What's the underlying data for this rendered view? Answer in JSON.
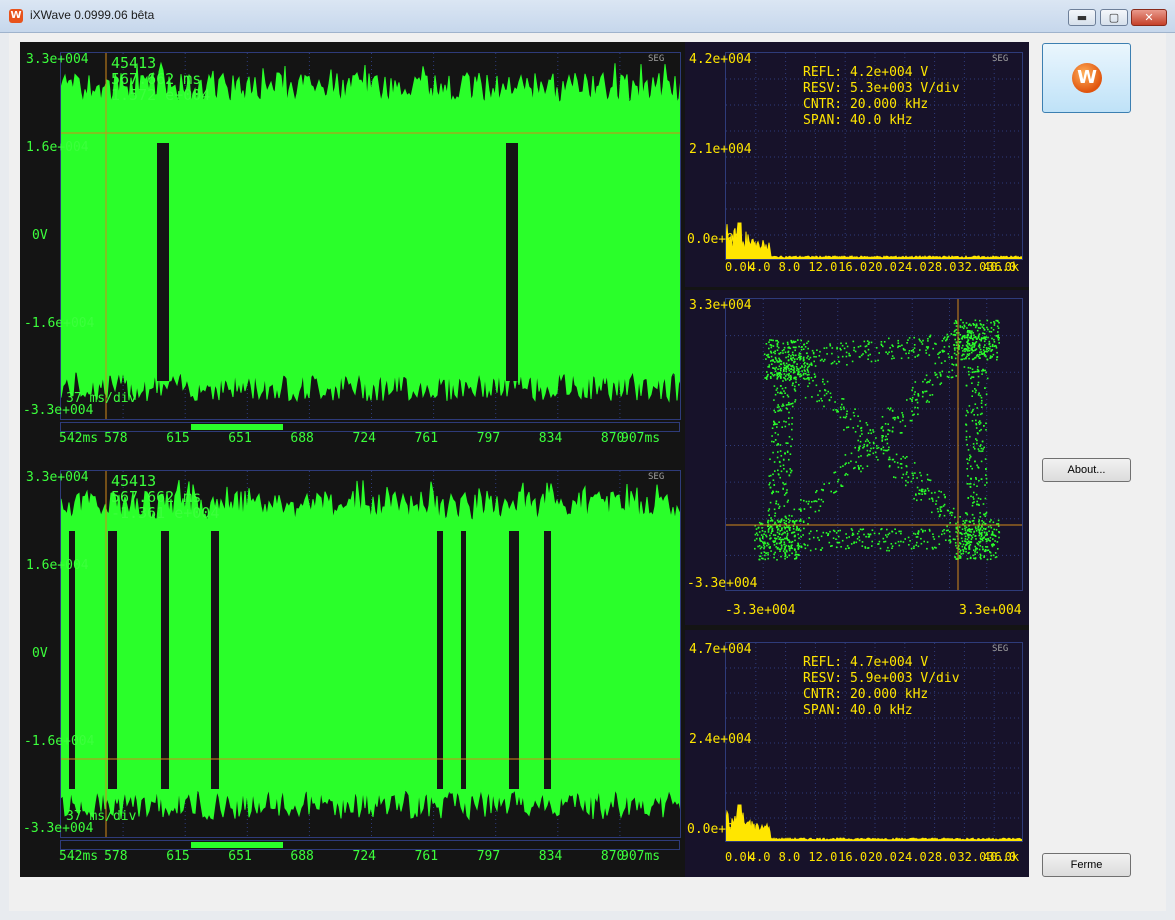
{
  "window": {
    "title": "iXWave 0.0999.06 bêta",
    "icon": "W",
    "controls": {
      "minimize": "▬",
      "maximize": "▢",
      "close": "✕"
    }
  },
  "buttons": {
    "logo": "W",
    "about": "About...",
    "close": "Ferme"
  },
  "colors": {
    "trace": "#2aff2a",
    "cursor": "#d38a1a",
    "spectrum": "#ffe600",
    "grid": "#2e3b7a",
    "panel": "#17122a"
  },
  "time_panels": [
    {
      "y_max": "3.3e+004",
      "y_mid_high": "1.6e+004",
      "y_zero": "0V",
      "y_mid_low": "-1.6e+004",
      "y_min": "-3.3e+004",
      "readout": [
        "45413",
        "567.662 ms",
        "1.572 e+004"
      ],
      "scale": "37 ms/div",
      "tag": "SEG",
      "x_ticks": [
        "542ms",
        "578",
        "615",
        "651",
        "688",
        "724",
        "761",
        "797",
        "834",
        "870",
        "907ms"
      ],
      "scroll": {
        "start": 0.21,
        "end": 0.36
      }
    },
    {
      "y_max": "3.3e+004",
      "y_mid_high": "1.6e+004",
      "y_zero": "0V",
      "y_mid_low": "-1.6e+004",
      "y_min": "-3.3e+004",
      "readout": [
        "45413",
        "567.662 ms",
        "-1.361 e+004"
      ],
      "scale": "37 ms/div",
      "tag": "SEG",
      "x_ticks": [
        "542ms",
        "578",
        "615",
        "651",
        "688",
        "724",
        "761",
        "797",
        "834",
        "870",
        "907ms"
      ],
      "scroll": {
        "start": 0.21,
        "end": 0.36
      }
    }
  ],
  "spectrum_panels": [
    {
      "y_ticks": [
        "4.2e+004",
        "2.1e+004",
        "0.0e+00"
      ],
      "info": [
        "REFL: 4.2e+004 V",
        "RESV: 5.3e+003 V/div",
        "CNTR: 20.000 kHz",
        "SPAN: 40.0 kHz"
      ],
      "tag": "SEG",
      "x_ticks": [
        "0.0k",
        "4.0",
        "8.0",
        "12.0",
        "16.0",
        "20.0",
        "24.0",
        "28.0",
        "32.0",
        "36.0",
        "40.0k"
      ]
    },
    {
      "y_ticks": [
        "4.7e+004",
        "2.4e+004",
        "0.0e+00"
      ],
      "info": [
        "REFL: 4.7e+004 V",
        "RESV: 5.9e+003 V/div",
        "CNTR: 20.000 kHz",
        "SPAN: 40.0 kHz"
      ],
      "tag": "SEG",
      "x_ticks": [
        "0.0k",
        "4.0",
        "8.0",
        "12.0",
        "16.0",
        "20.0",
        "24.0",
        "28.0",
        "32.0",
        "36.0",
        "40.0k"
      ]
    }
  ],
  "xy_panel": {
    "y_top": "3.3e+004",
    "y_bottom": "-3.3e+004",
    "x_left": "-3.3e+004",
    "x_right": "3.3e+004"
  }
}
